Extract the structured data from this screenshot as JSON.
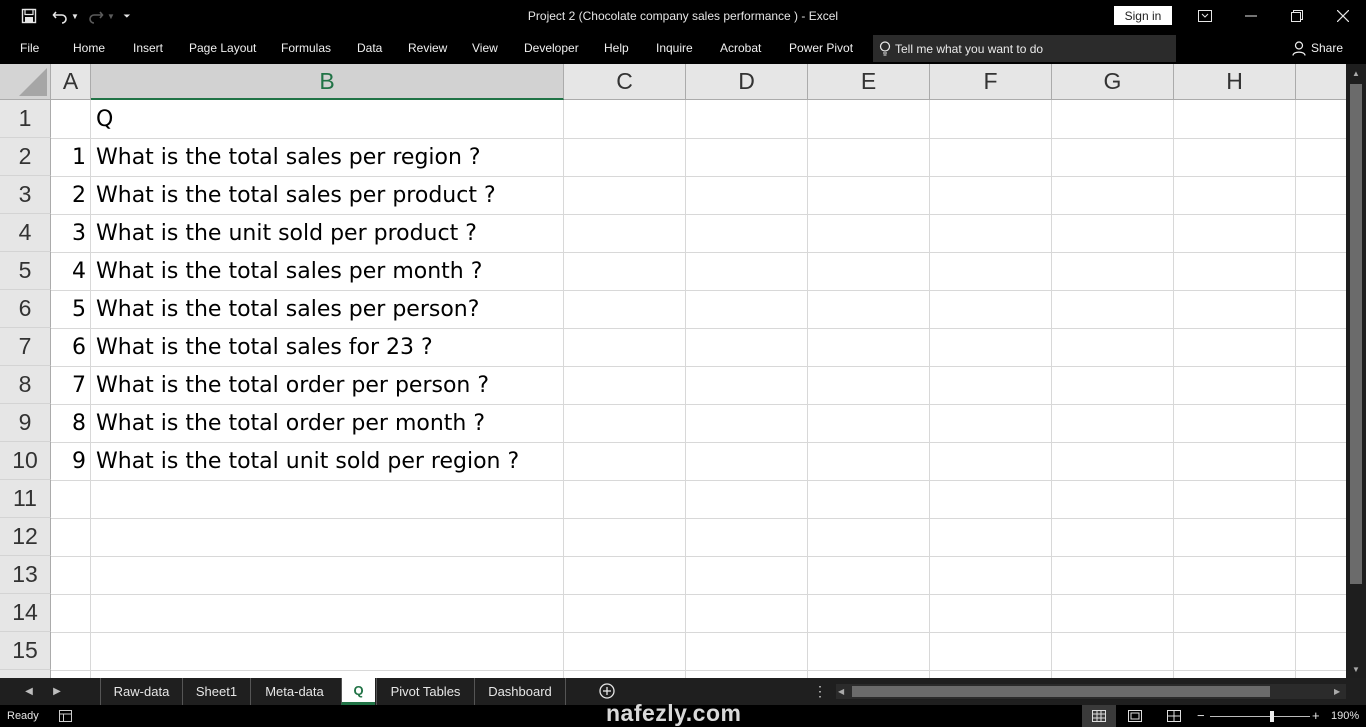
{
  "window": {
    "title": "Project 2 (Chocolate company sales performance )  -  Excel",
    "sign_in": "Sign in"
  },
  "ribbon": {
    "tabs": [
      "File",
      "Home",
      "Insert",
      "Page Layout",
      "Formulas",
      "Data",
      "Review",
      "View",
      "Developer",
      "Help",
      "Inquire",
      "Acrobat",
      "Power Pivot"
    ],
    "tell_me": "Tell me what you want to do",
    "share": "Share"
  },
  "grid": {
    "columns": [
      "A",
      "B",
      "C",
      "D",
      "E",
      "F",
      "G",
      "H"
    ],
    "selected_column": "B",
    "rows": [
      "1",
      "2",
      "3",
      "4",
      "5",
      "6",
      "7",
      "8",
      "9",
      "10",
      "11",
      "12",
      "13",
      "14",
      "15"
    ],
    "cells": [
      {
        "a": "",
        "b": "Q"
      },
      {
        "a": "1",
        "b": "What is the total sales per region ?"
      },
      {
        "a": "2",
        "b": "What is the total sales per product ?"
      },
      {
        "a": "3",
        "b": "What is the unit sold per product ?"
      },
      {
        "a": "4",
        "b": "What is the total sales per month ?"
      },
      {
        "a": "5",
        "b": "What is the total sales per person?"
      },
      {
        "a": "6",
        "b": "What is the total sales for 23 ?"
      },
      {
        "a": "7",
        "b": "What is the total order per person ?"
      },
      {
        "a": "8",
        "b": "What is the total order per month ?"
      },
      {
        "a": "9",
        "b": "What is the total unit sold per region ?"
      }
    ]
  },
  "sheets": {
    "tabs": [
      "Raw-data",
      "Sheet1",
      "Meta-data",
      "Q",
      "Pivot Tables",
      "Dashboard"
    ],
    "active": "Q"
  },
  "status": {
    "ready": "Ready",
    "zoom": "190%"
  },
  "watermark": "nafezly.com",
  "colors": {
    "accent": "#217346",
    "chrome": "#000000"
  }
}
